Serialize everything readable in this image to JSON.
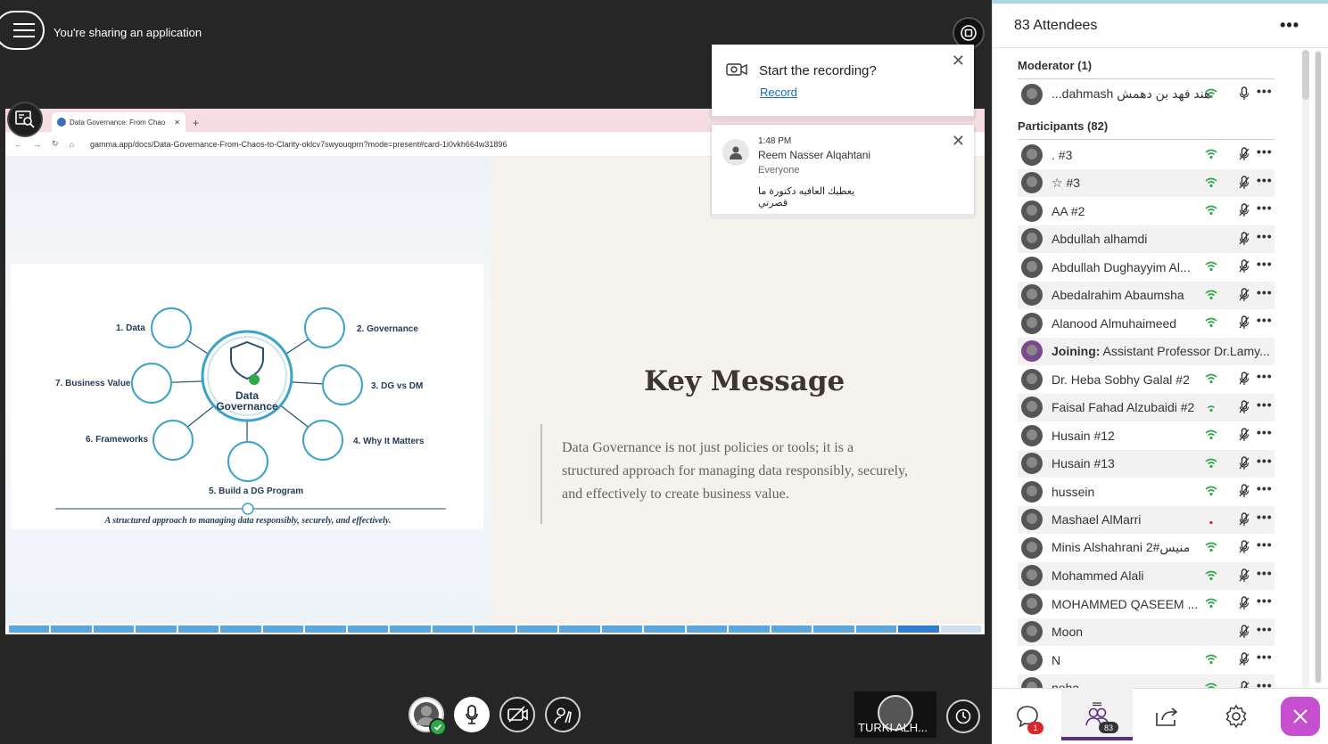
{
  "topbar": {
    "sharing_text": "You're sharing an application"
  },
  "browser": {
    "tab_title": "Data Governance: From Chao",
    "url": "gamma.app/docs/Data-Governance-From-Chaos-to-Clarity-oklcv7swyouqprn?mode=present#card-1i0vkh664w31896"
  },
  "slide": {
    "infographic": {
      "center_line1": "Data",
      "center_line2": "Governance",
      "items": [
        "1. Data",
        "2. Governance",
        "3. DG vs DM",
        "4. Why It Matters",
        "5. Build a DG Program",
        "6. Frameworks",
        "7. Business Value"
      ],
      "caption": "A structured approach to managing data responsibly, securely, and effectively."
    },
    "title": "Key Message",
    "body": "Data Governance is not just policies or tools; it is a structured approach for managing data responsibly, securely, and effectively to create business value.",
    "progress": {
      "segments": 22,
      "current": 22
    }
  },
  "notifications": {
    "recording": {
      "title": "Start the recording?",
      "link": "Record"
    },
    "chat": {
      "time": "1:48 PM",
      "sender": "Reem Nasser Alqahtani",
      "audience": "Everyone",
      "message": "يعطيك العافيه دكتورة ما قصرتي"
    }
  },
  "bottom": {
    "video_label": "TURKI ALH..."
  },
  "panel": {
    "title": "83 Attendees",
    "moderator_heading": "Moderator (1)",
    "moderator": "هند فهد بن دهمش dahmash...",
    "participants_heading": "Participants (82)",
    "participants": [
      {
        "name": ". #3",
        "signal": "full"
      },
      {
        "name": "☆ #3",
        "signal": "full"
      },
      {
        "name": "AA #2",
        "signal": "full"
      },
      {
        "name": "Abdullah alhamdi",
        "signal": "none"
      },
      {
        "name": "Abdullah Dughayyim Al...",
        "signal": "full"
      },
      {
        "name": "Abedalrahim Abaumsha",
        "signal": "full"
      },
      {
        "name": "Alanood Almuhaimeed",
        "signal": "full"
      },
      {
        "joining_label": "Joining:",
        "name": " Assistant Professor Dr.Lamy...",
        "signal": "none"
      },
      {
        "name": "Dr. Heba Sobhy Galal #2",
        "signal": "full"
      },
      {
        "name": "Faisal Fahad Alzubaidi #2",
        "signal": "weak"
      },
      {
        "name": "Husain #12",
        "signal": "full"
      },
      {
        "name": "Husain #13",
        "signal": "full"
      },
      {
        "name": "hussein",
        "signal": "full"
      },
      {
        "name": "Mashael AlMarri",
        "signal": "red"
      },
      {
        "name": "Minis Alshahrani 2#منيس",
        "signal": "full"
      },
      {
        "name": "Mohammed Alali",
        "signal": "full"
      },
      {
        "name": "MOHAMMED QASEEM ...",
        "signal": "full"
      },
      {
        "name": "Moon",
        "signal": "none"
      },
      {
        "name": "N",
        "signal": "full"
      },
      {
        "name": "noha",
        "signal": "full"
      }
    ],
    "tabs": {
      "chat_badge": "1",
      "attendees_badge": "83"
    }
  },
  "colors": {
    "accent_purple": "#5b2c83",
    "close_pink": "#c64fd0",
    "signal_green": "#2ea84a",
    "signal_red": "#d9262a",
    "progress_blue": "#5aa6e0"
  }
}
